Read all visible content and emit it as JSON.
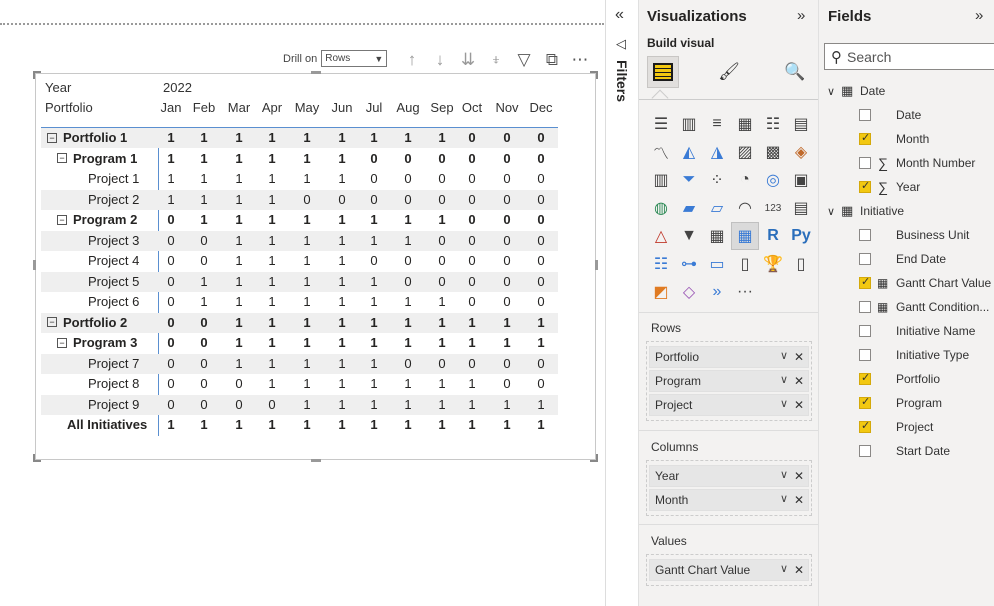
{
  "canvas": {
    "drill_on_label": "Drill on",
    "drill_select": "Rows",
    "toolbar_icons": [
      "drill-up-icon",
      "drill-down-icon",
      "expand-next-level-icon",
      "expand-hierarchy-icon",
      "filter-icon",
      "focus-mode-icon",
      "more-options-icon"
    ]
  },
  "matrix": {
    "year_label": "Year",
    "year_value": "2022",
    "portfolio_label": "Portfolio",
    "months": [
      "Jan",
      "Feb",
      "Mar",
      "Apr",
      "May",
      "Jun",
      "Jul",
      "Aug",
      "Sep",
      "Oct",
      "Nov",
      "Dec"
    ],
    "rows": [
      {
        "label": "Portfolio 1",
        "level": 0,
        "bold": true,
        "expander": "−",
        "values": [
          "1",
          "1",
          "1",
          "1",
          "1",
          "1",
          "1",
          "1",
          "1",
          "0",
          "0",
          "0"
        ]
      },
      {
        "label": "Program 1",
        "level": 1,
        "bold": true,
        "expander": "−",
        "values": [
          "1",
          "1",
          "1",
          "1",
          "1",
          "1",
          "0",
          "0",
          "0",
          "0",
          "0",
          "0"
        ]
      },
      {
        "label": "Project 1",
        "level": 2,
        "bold": false,
        "values": [
          "1",
          "1",
          "1",
          "1",
          "1",
          "1",
          "0",
          "0",
          "0",
          "0",
          "0",
          "0"
        ]
      },
      {
        "label": "Project 2",
        "level": 2,
        "bold": false,
        "values": [
          "1",
          "1",
          "1",
          "1",
          "0",
          "0",
          "0",
          "0",
          "0",
          "0",
          "0",
          "0"
        ]
      },
      {
        "label": "Program 2",
        "level": 1,
        "bold": true,
        "expander": "−",
        "values": [
          "0",
          "1",
          "1",
          "1",
          "1",
          "1",
          "1",
          "1",
          "1",
          "0",
          "0",
          "0"
        ]
      },
      {
        "label": "Project 3",
        "level": 2,
        "bold": false,
        "values": [
          "0",
          "0",
          "1",
          "1",
          "1",
          "1",
          "1",
          "1",
          "0",
          "0",
          "0",
          "0"
        ]
      },
      {
        "label": "Project 4",
        "level": 2,
        "bold": false,
        "values": [
          "0",
          "0",
          "1",
          "1",
          "1",
          "1",
          "0",
          "0",
          "0",
          "0",
          "0",
          "0"
        ]
      },
      {
        "label": "Project 5",
        "level": 2,
        "bold": false,
        "values": [
          "0",
          "1",
          "1",
          "1",
          "1",
          "1",
          "1",
          "0",
          "0",
          "0",
          "0",
          "0"
        ]
      },
      {
        "label": "Project 6",
        "level": 2,
        "bold": false,
        "values": [
          "0",
          "1",
          "1",
          "1",
          "1",
          "1",
          "1",
          "1",
          "1",
          "0",
          "0",
          "0"
        ]
      },
      {
        "label": "Portfolio 2",
        "level": 0,
        "bold": true,
        "expander": "−",
        "values": [
          "0",
          "0",
          "1",
          "1",
          "1",
          "1",
          "1",
          "1",
          "1",
          "1",
          "1",
          "1"
        ]
      },
      {
        "label": "Program 3",
        "level": 1,
        "bold": true,
        "expander": "−",
        "values": [
          "0",
          "0",
          "1",
          "1",
          "1",
          "1",
          "1",
          "1",
          "1",
          "1",
          "1",
          "1"
        ]
      },
      {
        "label": "Project 7",
        "level": 2,
        "bold": false,
        "values": [
          "0",
          "0",
          "1",
          "1",
          "1",
          "1",
          "1",
          "0",
          "0",
          "0",
          "0",
          "0"
        ]
      },
      {
        "label": "Project 8",
        "level": 2,
        "bold": false,
        "values": [
          "0",
          "0",
          "0",
          "1",
          "1",
          "1",
          "1",
          "1",
          "1",
          "1",
          "0",
          "0"
        ]
      },
      {
        "label": "Project 9",
        "level": 2,
        "bold": false,
        "values": [
          "0",
          "0",
          "0",
          "0",
          "1",
          "1",
          "1",
          "1",
          "1",
          "1",
          "1",
          "1"
        ]
      },
      {
        "label": "All Initiatives",
        "level": 0,
        "bold": true,
        "total": true,
        "values": [
          "1",
          "1",
          "1",
          "1",
          "1",
          "1",
          "1",
          "1",
          "1",
          "1",
          "1",
          "1"
        ]
      }
    ]
  },
  "filters": {
    "title": "Filters"
  },
  "visualizations": {
    "title": "Visualizations",
    "build_visual": "Build visual",
    "rows_label": "Rows",
    "rows": [
      "Portfolio",
      "Program",
      "Project"
    ],
    "columns_label": "Columns",
    "columns": [
      "Year",
      "Month"
    ],
    "values_label": "Values",
    "values": [
      "Gantt Chart Value"
    ],
    "r_label": "R",
    "py_label": "Py",
    "more": "···"
  },
  "fields": {
    "title": "Fields",
    "search_placeholder": "Search",
    "tables": [
      {
        "name": "Date",
        "fields": [
          {
            "name": "Date",
            "checked": false,
            "type": ""
          },
          {
            "name": "Month",
            "checked": true,
            "type": ""
          },
          {
            "name": "Month Number",
            "checked": false,
            "type": "sigma"
          },
          {
            "name": "Year",
            "checked": true,
            "type": "sigma"
          }
        ]
      },
      {
        "name": "Initiative",
        "fields": [
          {
            "name": "Business Unit",
            "checked": false,
            "type": ""
          },
          {
            "name": "End Date",
            "checked": false,
            "type": ""
          },
          {
            "name": "Gantt Chart Value",
            "checked": true,
            "type": "calc"
          },
          {
            "name": "Gantt Condition...",
            "checked": false,
            "type": "calc"
          },
          {
            "name": "Initiative Name",
            "checked": false,
            "type": ""
          },
          {
            "name": "Initiative Type",
            "checked": false,
            "type": ""
          },
          {
            "name": "Portfolio",
            "checked": true,
            "type": ""
          },
          {
            "name": "Program",
            "checked": true,
            "type": ""
          },
          {
            "name": "Project",
            "checked": true,
            "type": ""
          },
          {
            "name": "Start Date",
            "checked": false,
            "type": ""
          }
        ]
      }
    ]
  }
}
